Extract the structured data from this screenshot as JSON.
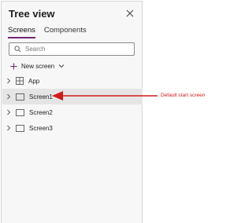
{
  "panel": {
    "title": "Tree view",
    "tabs": [
      {
        "label": "Screens",
        "active": true
      },
      {
        "label": "Components",
        "active": false
      }
    ],
    "search_placeholder": "Search",
    "new_screen_label": "New screen",
    "items": [
      {
        "label": "App",
        "icon": "app-grid-icon",
        "selected": false
      },
      {
        "label": "Screen1",
        "icon": "screen-icon",
        "selected": true
      },
      {
        "label": "Screen2",
        "icon": "screen-icon",
        "selected": false
      },
      {
        "label": "Screen3",
        "icon": "screen-icon",
        "selected": false
      }
    ]
  },
  "annotation": {
    "text": "Default start screen",
    "color": "#d11a1a"
  },
  "colors": {
    "tab_accent": "#742774",
    "new_screen_plus": "#742774"
  }
}
